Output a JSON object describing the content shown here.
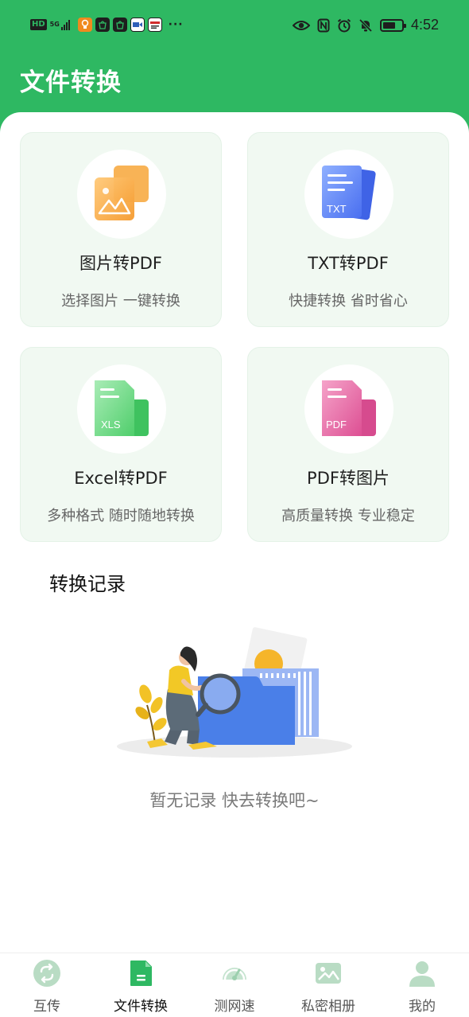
{
  "status_bar": {
    "network_left": "HD",
    "network_gen": "5G",
    "time": "4:52",
    "more_indicator": "···",
    "battery_level": 0.7,
    "icons": [
      "eye-icon",
      "nfc-icon",
      "alarm-icon",
      "mute-bell-icon",
      "battery-icon"
    ]
  },
  "header": {
    "title": "文件转换"
  },
  "cards": [
    {
      "title": "图片转PDF",
      "subtitle": "选择图片 一键转换",
      "icon": "image-icon",
      "color": "#f6a93b"
    },
    {
      "title": "TXT转PDF",
      "subtitle": "快捷转换 省时省心",
      "icon": "txt-doc-icon",
      "icon_text": "TXT",
      "color": "#4a7ef0"
    },
    {
      "title": "Excel转PDF",
      "subtitle": "多种格式 随时随地转换",
      "icon": "xls-doc-icon",
      "icon_text": "XLS",
      "color": "#4cce6b"
    },
    {
      "title": "PDF转图片",
      "subtitle": "高质量转换 专业稳定",
      "icon": "pdf-doc-icon",
      "icon_text": "PDF",
      "color": "#e0569a"
    }
  ],
  "records": {
    "title": "转换记录",
    "empty_text": "暂无记录 快去转换吧~"
  },
  "bottom_nav": {
    "items": [
      {
        "label": "互传",
        "icon": "transfer-icon",
        "active": false
      },
      {
        "label": "文件转换",
        "icon": "file-convert-icon",
        "active": true
      },
      {
        "label": "测网速",
        "icon": "speedometer-icon",
        "active": false
      },
      {
        "label": "私密相册",
        "icon": "private-album-icon",
        "active": false
      },
      {
        "label": "我的",
        "icon": "profile-icon",
        "active": false
      }
    ]
  },
  "colors": {
    "brand_green": "#2eb862",
    "card_bg": "#f1f9f2",
    "nav_icon_inactive": "#b9dcc4"
  }
}
